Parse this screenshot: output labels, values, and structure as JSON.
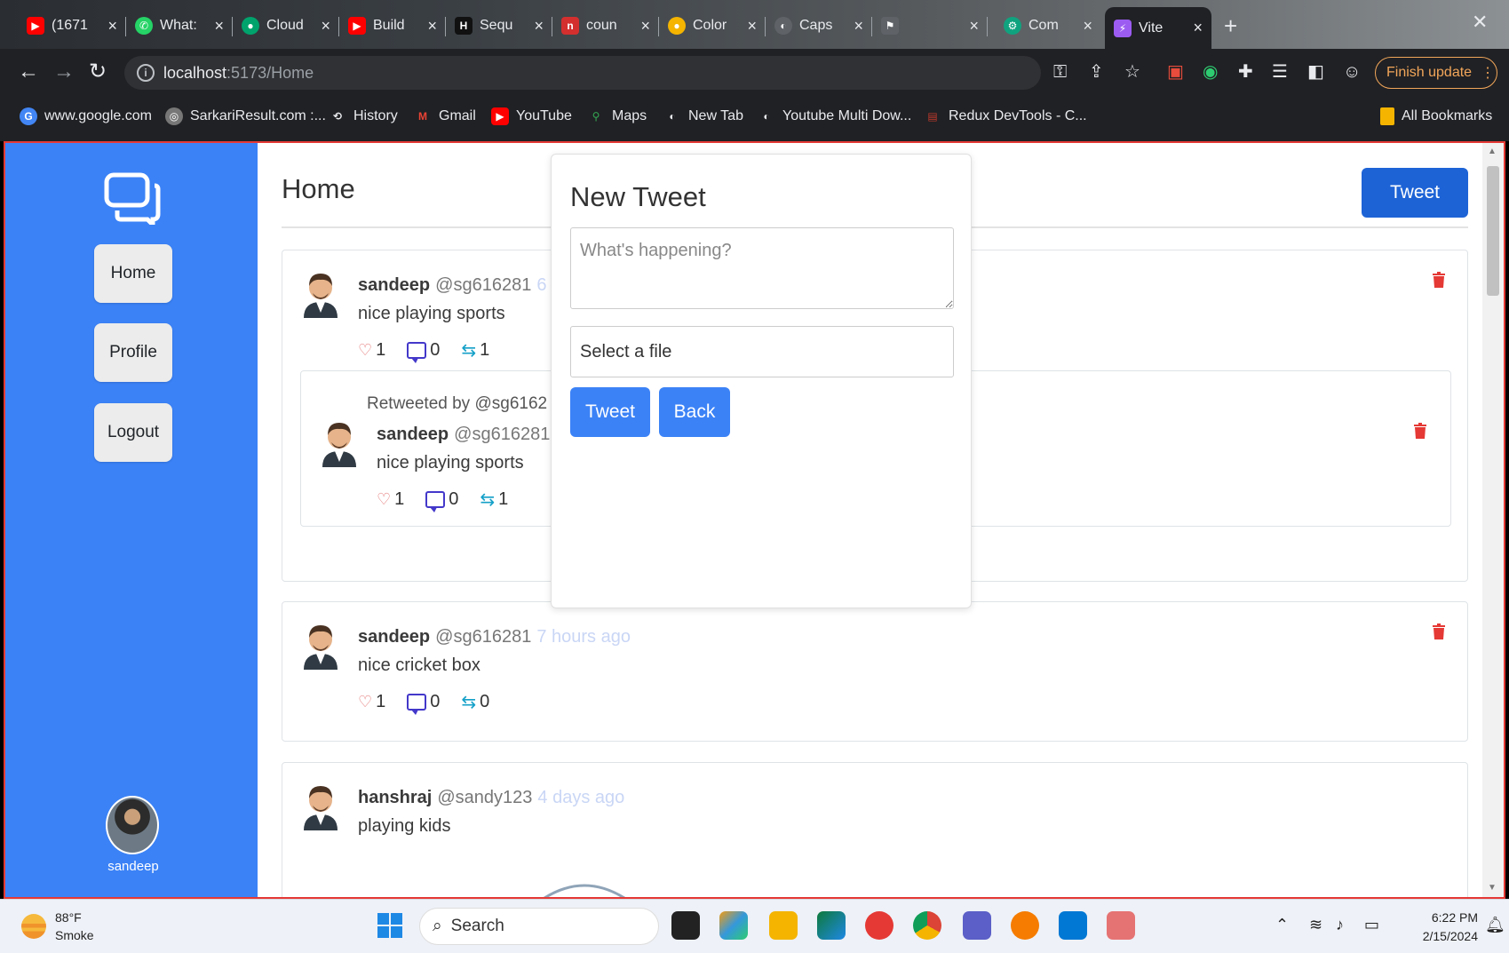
{
  "browser": {
    "tabs": [
      {
        "label": "(1671",
        "color": "#ff0000",
        "glyph": "▶"
      },
      {
        "label": "What:",
        "color": "#25d366",
        "glyph": "✆"
      },
      {
        "label": "Cloud",
        "color": "#00a36c",
        "glyph": "●"
      },
      {
        "label": "Build",
        "color": "#ff0000",
        "glyph": "▶"
      },
      {
        "label": "Sequ",
        "color": "#111111",
        "glyph": "H"
      },
      {
        "label": "coun",
        "color": "#d32f2f",
        "glyph": "n"
      },
      {
        "label": "Color",
        "color": "#f4b400",
        "glyph": "●"
      },
      {
        "label": "Caps",
        "color": "#5f6368",
        "glyph": "◐"
      },
      {
        "label": "",
        "color": "#5f6368",
        "glyph": "⚑"
      },
      {
        "label": "Com",
        "color": "#10a37f",
        "glyph": "⚙"
      }
    ],
    "active_tab": {
      "label": "Vite",
      "color": "#9c5cf2",
      "glyph": "⚡"
    },
    "url_host": "localhost",
    "url_path": ":5173/Home",
    "finish_update": "Finish update",
    "bookmarks": [
      {
        "label": "www.google.com",
        "color": "#4285f4",
        "glyph": "G"
      },
      {
        "label": "SarkariResult.com :...",
        "color": "#777777",
        "glyph": "◎"
      },
      {
        "label": "History",
        "color": "#5f6368",
        "glyph": "⟲"
      },
      {
        "label": "Gmail",
        "color": "#ea4335",
        "glyph": "M"
      },
      {
        "label": "YouTube",
        "color": "#ff0000",
        "glyph": "▶"
      },
      {
        "label": "Maps",
        "color": "#34a853",
        "glyph": "⚲"
      },
      {
        "label": "New Tab",
        "color": "#5f6368",
        "glyph": "◐"
      },
      {
        "label": "Youtube Multi Dow...",
        "color": "#5f6368",
        "glyph": "◐"
      },
      {
        "label": "Redux DevTools - C...",
        "color": "#c0392b",
        "glyph": "▤"
      }
    ],
    "all_bookmarks": "All Bookmarks"
  },
  "sidebar": {
    "items": [
      "Home",
      "Profile",
      "Logout"
    ],
    "user_name": "sandeep"
  },
  "main": {
    "title": "Home",
    "tweet_button": "Tweet",
    "tweets": [
      {
        "name": "sandeep",
        "handle": "@sg616281",
        "ago": "6",
        "content": "nice playing sports",
        "likes": "1",
        "comments": "0",
        "retweets": "1",
        "retweet": {
          "retweeted_by": "Retweeted by @sg6162",
          "name": "sandeep",
          "handle": "@sg616281",
          "content": "nice playing sports",
          "likes": "1",
          "comments": "0",
          "retweets": "1"
        }
      },
      {
        "name": "sandeep",
        "handle": "@sg616281",
        "ago": "7 hours ago",
        "content": "nice cricket box",
        "likes": "1",
        "comments": "0",
        "retweets": "0"
      },
      {
        "name": "hanshraj",
        "handle": "@sandy123",
        "ago": "4 days ago",
        "content": "playing kids"
      }
    ]
  },
  "modal": {
    "title": "New Tweet",
    "placeholder": "What's happening?",
    "file_label": "Select a file",
    "tweet_button": "Tweet",
    "back_button": "Back"
  },
  "taskbar": {
    "temp": "88°F",
    "condition": "Smoke",
    "search": "Search",
    "time": "6:22 PM",
    "date": "2/15/2024"
  },
  "colors": {
    "sidebar": "#3b82f6",
    "primary_button": "#1d63d6",
    "delete": "#e53935"
  }
}
